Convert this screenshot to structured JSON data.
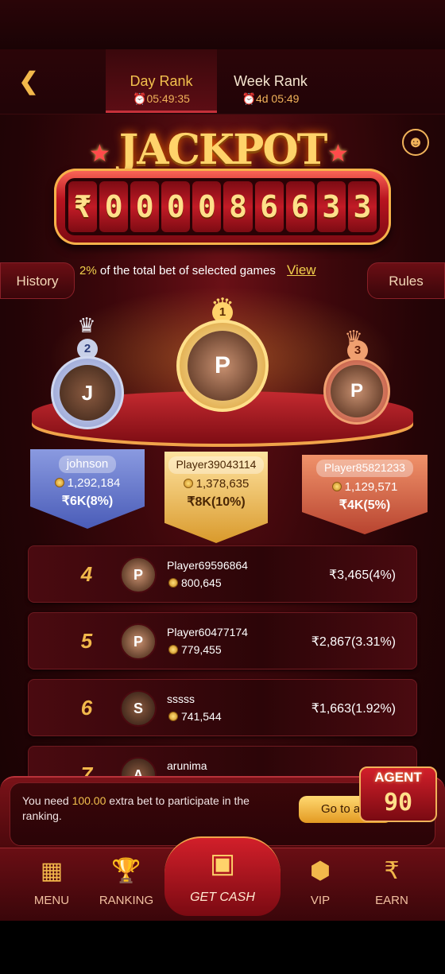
{
  "header": {
    "back_icon": "chevron-left-icon",
    "tabs": [
      {
        "label": "Day Rank",
        "timer": "05:49:35",
        "active": true
      },
      {
        "label": "Week Rank",
        "timer": "4d 05:49",
        "active": false
      }
    ]
  },
  "jackpot": {
    "title": "JACKPOT",
    "digits": [
      "₹",
      "0",
      "0",
      "0",
      "0",
      "8",
      "6",
      "6",
      "3",
      "3"
    ],
    "tagline_pct": "2%",
    "tagline_text": "of the total bet of selected games",
    "view_label": "View",
    "history_label": "History",
    "rules_label": "Rules"
  },
  "podium": [
    {
      "rank": "2",
      "name": "johnson",
      "score": "1,292,184",
      "reward": "₹6K(8%)"
    },
    {
      "rank": "1",
      "name": "Player39043114",
      "score": "1,378,635",
      "reward": "₹8K(10%)"
    },
    {
      "rank": "3",
      "name": "Player85821233",
      "score": "1,129,571",
      "reward": "₹4K(5%)"
    }
  ],
  "list": [
    {
      "rank": "4",
      "name": "Player69596864",
      "score": "800,645",
      "reward": "₹3,465(4%)"
    },
    {
      "rank": "5",
      "name": "Player60477174",
      "score": "779,455",
      "reward": "₹2,867(3.31%)"
    },
    {
      "rank": "6",
      "name": "sssss",
      "score": "741,544",
      "reward": "₹1,663(1.92%)"
    },
    {
      "rank": "7",
      "name": "arunima",
      "score": "",
      "reward": ""
    }
  ],
  "notice": {
    "prefix": "You need",
    "amount": "100.00",
    "suffix": "extra bet to participate in the ranking.",
    "button": "Go to a",
    "agent_label": "AGENT",
    "agent_digits": "90"
  },
  "nav": [
    {
      "label": "MENU",
      "icon": "menu-grid-icon"
    },
    {
      "label": "RANKING",
      "icon": "trophy-icon"
    },
    {
      "label": "GET CASH",
      "icon": "treasure-chest-icon"
    },
    {
      "label": "VIP",
      "icon": "vip-badge-icon"
    },
    {
      "label": "EARN",
      "icon": "rupee-icon"
    }
  ],
  "colors": {
    "gold": "#f2b84b",
    "accent": "#c5303a",
    "background": "#3c070b"
  }
}
